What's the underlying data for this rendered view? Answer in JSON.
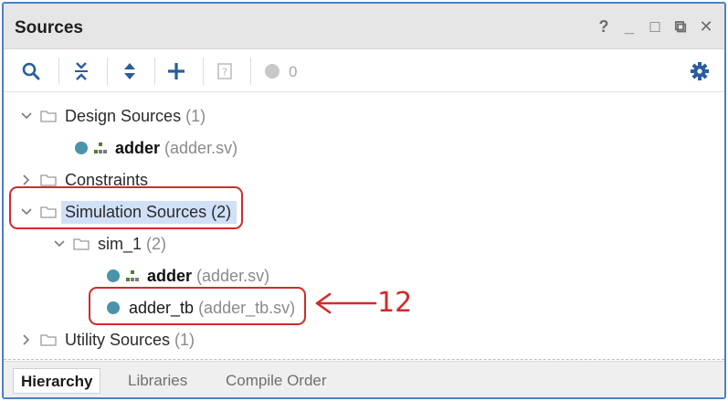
{
  "panel": {
    "title": "Sources",
    "controls": [
      "?",
      "_",
      "□",
      "⧉",
      "✕"
    ]
  },
  "toolbar": {
    "search_icon": "search-icon",
    "collapse_all_icon": "collapse-all-icon",
    "expand_all_icon": "expand-all-icon",
    "add_icon": "add-icon",
    "help_icon": "question-box-icon",
    "status_count": "0",
    "settings_icon": "gear-icon"
  },
  "tree": {
    "design_sources": {
      "label": "Design Sources",
      "count": "(1)"
    },
    "design_adder": {
      "name": "adder",
      "file": "(adder.sv)"
    },
    "constraints": {
      "label": "Constraints"
    },
    "simulation_sources": {
      "label": "Simulation Sources (2)"
    },
    "sim_1": {
      "label": "sim_1",
      "count": "(2)"
    },
    "sim_adder": {
      "name": "adder",
      "file": "(adder.sv)"
    },
    "sim_adder_tb": {
      "name": "adder_tb",
      "file": "(adder_tb.sv)"
    },
    "utility_sources": {
      "label": "Utility Sources",
      "count": "(1)"
    }
  },
  "tabs": [
    {
      "label": "Hierarchy",
      "active": true
    },
    {
      "label": "Libraries",
      "active": false
    },
    {
      "label": "Compile Order",
      "active": false
    }
  ],
  "annotation": {
    "number": "12",
    "color": "#d02b2b"
  },
  "colors": {
    "accent_border": "#4a80c8",
    "selection": "#cfe0f7",
    "dot": "#4a94ab",
    "toolbar_icon": "#2a5d9e"
  }
}
